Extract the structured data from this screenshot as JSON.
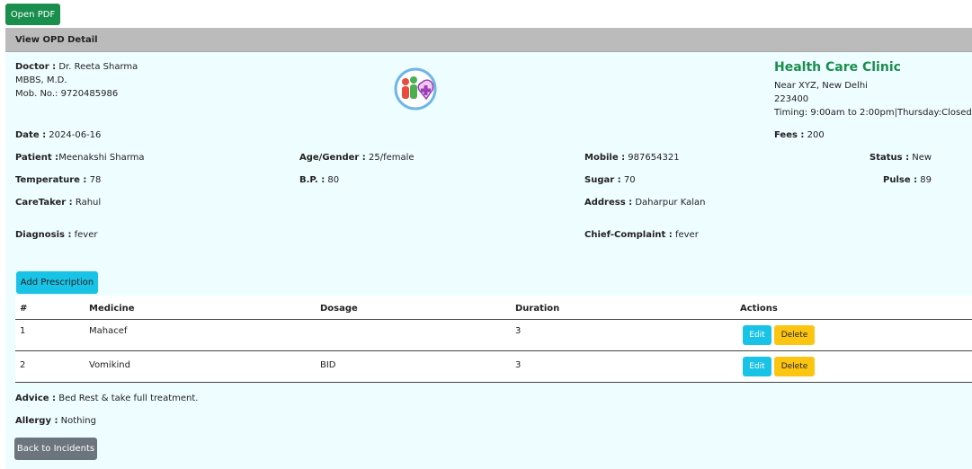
{
  "open_pdf_label": "Open PDF",
  "header_title": "View OPD Detail",
  "doctor": {
    "label": "Doctor :",
    "name": "Dr. Reeta Sharma",
    "degree": "MBBS, M.D.",
    "mobile": "Mob. No.: 9720485986"
  },
  "clinic": {
    "name": "Health Care Clinic",
    "address": "Near XYZ, New Delhi",
    "pin": "223400",
    "timing": "Timing: 9:00am to 2:00pm|Thursday:Closed"
  },
  "fields": {
    "date_label": "Date :",
    "date": "2024-06-16",
    "fees_label": "Fees :",
    "fees": "200",
    "patient_label": "Patient :",
    "patient": "Meenakshi Sharma",
    "age_label": "Age/Gender :",
    "age": "25/female",
    "mobile_label": "Mobile :",
    "mobile": "987654321",
    "status_label": "Status :",
    "status": "New",
    "temp_label": "Temperature :",
    "temp": "78",
    "bp_label": "B.P. :",
    "bp": "80",
    "sugar_label": "Sugar :",
    "sugar": "70",
    "pulse_label": "Pulse :",
    "pulse": "89",
    "caretaker_label": "CareTaker :",
    "caretaker": "Rahul",
    "address_label": "Address :",
    "address": "Daharpur Kalan",
    "diagnosis_label": "Diagnosis :",
    "diagnosis": "fever",
    "complaint_label": "Chief-Complaint :",
    "complaint": "fever"
  },
  "add_prescription_label": "Add Prescription",
  "table": {
    "headers": [
      "#",
      "Medicine",
      "Dosage",
      "Duration",
      "Actions"
    ],
    "rows": [
      {
        "num": "1",
        "medicine": "Mahacef",
        "dosage": "",
        "duration": "3"
      },
      {
        "num": "2",
        "medicine": "Vomikind",
        "dosage": "BID",
        "duration": "3"
      }
    ],
    "edit_label": "Edit",
    "delete_label": "Delete"
  },
  "advice_label": "Advice :",
  "advice": "Bed Rest & take full treatment.",
  "allergy_label": "Allergy :",
  "allergy": "Nothing",
  "back_label": "Back to Incidents",
  "colors": {
    "green": "#1a8e4d",
    "cyan": "#19c3e6",
    "yellow": "#fcc512",
    "gray": "#6c757d"
  }
}
